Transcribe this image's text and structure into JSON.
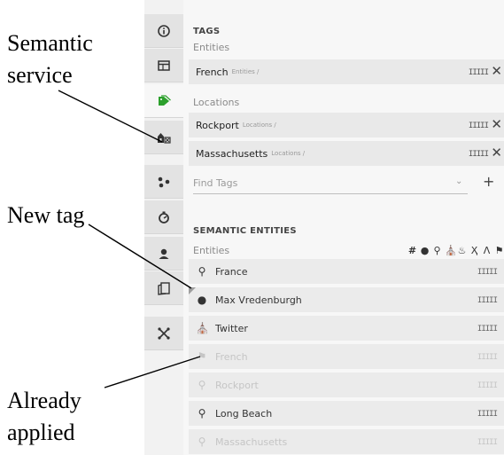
{
  "annotations": {
    "semantic_service": [
      "Semantic",
      "service"
    ],
    "new_tag": "New tag",
    "already_applied": [
      "Already",
      "applied"
    ]
  },
  "rail": {
    "icons": [
      "info-icon",
      "panel-icon",
      "tag-icon",
      "semantic-service-icon",
      "nodes-icon",
      "timer-icon",
      "person-icon",
      "pages-icon",
      "network-icon"
    ],
    "active_index": 2,
    "accent_color": "#2ca02c"
  },
  "tags": {
    "title": "TAGS",
    "entities_label": "Entities",
    "entities": [
      {
        "name": "French",
        "path": "Entities /"
      }
    ],
    "locations_label": "Locations",
    "locations": [
      {
        "name": "Rockport",
        "path": "Locations /"
      },
      {
        "name": "Massachusetts",
        "path": "Locations /"
      }
    ],
    "find_placeholder": "Find Tags",
    "add_symbol": "+",
    "remove_symbol": "✕",
    "relevance_bars": "IIIII"
  },
  "semantic": {
    "title": "SEMANTIC ENTITIES",
    "entities_label": "Entities",
    "type_icons": [
      "#",
      "person",
      "location",
      "institution",
      "education",
      "human",
      "landmark",
      "flag"
    ],
    "items": [
      {
        "name": "France",
        "icon": "location-pin-icon",
        "applied": false,
        "new": false
      },
      {
        "name": "Max Vredenburgh",
        "icon": "person-icon",
        "applied": false,
        "new": true
      },
      {
        "name": "Twitter",
        "icon": "institution-icon",
        "applied": false,
        "new": false
      },
      {
        "name": "French",
        "icon": "flag-icon",
        "applied": true,
        "new": false
      },
      {
        "name": "Rockport",
        "icon": "location-pin-icon",
        "applied": true,
        "new": false
      },
      {
        "name": "Long Beach",
        "icon": "location-pin-icon",
        "applied": false,
        "new": false
      },
      {
        "name": "Massachusetts",
        "icon": "location-pin-icon",
        "applied": true,
        "new": false
      }
    ],
    "relevance_bars": "IIIII"
  }
}
